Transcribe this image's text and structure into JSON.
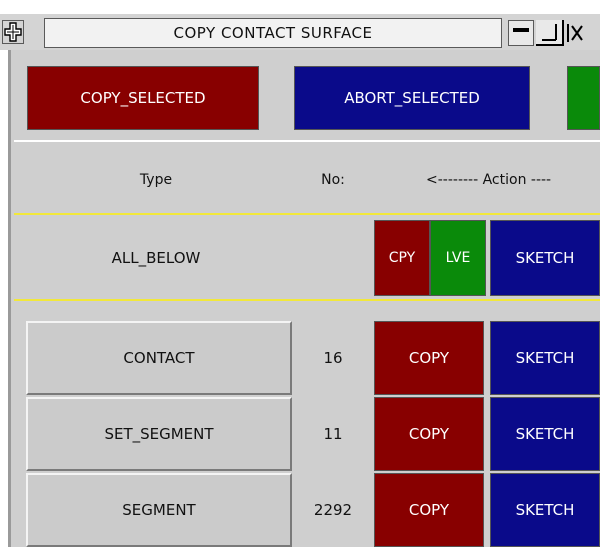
{
  "window": {
    "title": "COPY CONTACT SURFACE",
    "icons": [
      "move-icon",
      "minimize-icon",
      "restore-icon",
      "close-icon"
    ]
  },
  "toolbar": {
    "copy_selected": "COPY_SELECTED",
    "abort_selected": "ABORT_SELECTED"
  },
  "table": {
    "headers": {
      "type": "Type",
      "no": "No:",
      "action": "<-------- Action ----"
    },
    "all_below": {
      "label": "ALL_BELOW",
      "cpy": "CPY",
      "lve": "LVE",
      "sketch": "SKETCH"
    },
    "rows": [
      {
        "type": "CONTACT",
        "count": "16",
        "copy": "COPY",
        "sketch": "SKETCH"
      },
      {
        "type": "SET_SEGMENT",
        "count": "11",
        "copy": "COPY",
        "sketch": "SKETCH"
      },
      {
        "type": "SEGMENT",
        "count": "2292",
        "copy": "COPY",
        "sketch": "SKETCH"
      }
    ]
  },
  "colors": {
    "copy": "#880000",
    "abort": "#0a0a8a",
    "leave": "#0a8a0a",
    "panel": "#cfcfcf",
    "divider": "#f2e83a"
  }
}
